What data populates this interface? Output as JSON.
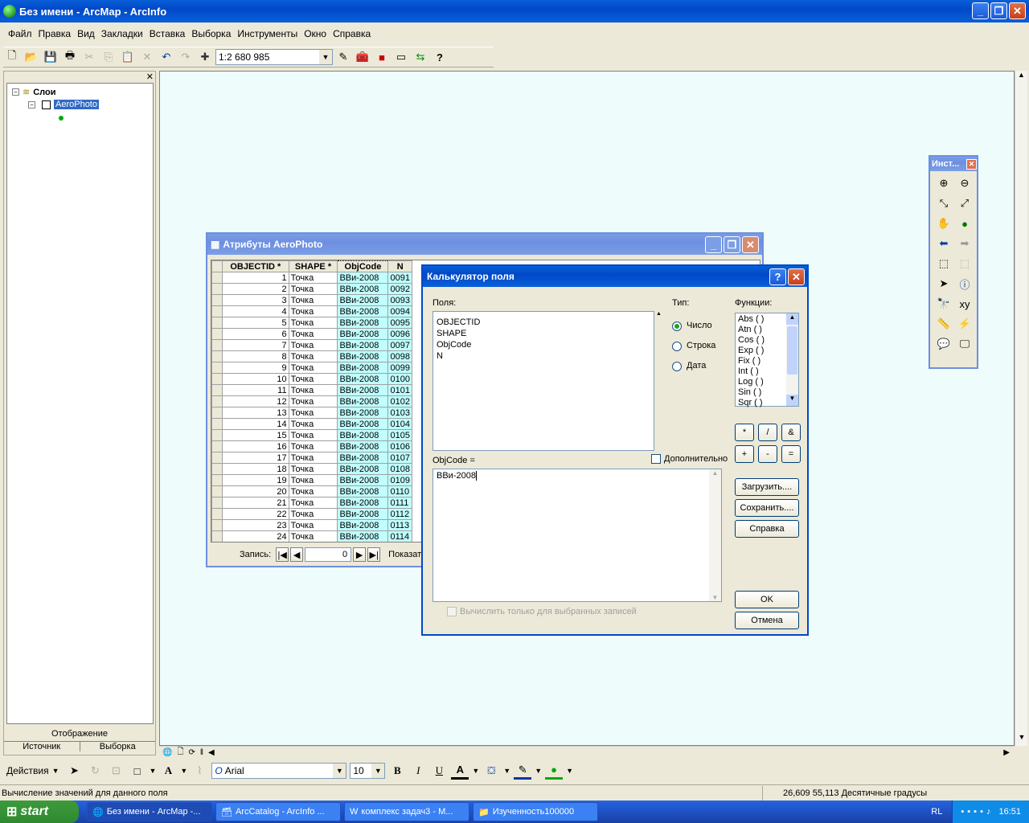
{
  "window": {
    "title": "Без имени - ArcMap - ArcInfo"
  },
  "menu": [
    "Файл",
    "Правка",
    "Вид",
    "Закладки",
    "Вставка",
    "Выборка",
    "Инструменты",
    "Окно",
    "Справка"
  ],
  "toolbar": {
    "scale": "1:2 680 985"
  },
  "toc": {
    "root": "Слои",
    "layer": "AeroPhoto",
    "tabs": [
      "Отображение",
      "Источник",
      "Выборка"
    ]
  },
  "tools_panel": {
    "title": "Инст..."
  },
  "attr": {
    "title": "Атрибуты AeroPhoto",
    "columns": [
      "OBJECTID *",
      "SHAPE *",
      "ObjCode",
      "N"
    ],
    "rows": [
      [
        "1",
        "Точка",
        "ВВи-2008",
        "0091"
      ],
      [
        "2",
        "Точка",
        "ВВи-2008",
        "0092"
      ],
      [
        "3",
        "Точка",
        "ВВи-2008",
        "0093"
      ],
      [
        "4",
        "Точка",
        "ВВи-2008",
        "0094"
      ],
      [
        "5",
        "Точка",
        "ВВи-2008",
        "0095"
      ],
      [
        "6",
        "Точка",
        "ВВи-2008",
        "0096"
      ],
      [
        "7",
        "Точка",
        "ВВи-2008",
        "0097"
      ],
      [
        "8",
        "Точка",
        "ВВи-2008",
        "0098"
      ],
      [
        "9",
        "Точка",
        "ВВи-2008",
        "0099"
      ],
      [
        "10",
        "Точка",
        "ВВи-2008",
        "0100"
      ],
      [
        "11",
        "Точка",
        "ВВи-2008",
        "0101"
      ],
      [
        "12",
        "Точка",
        "ВВи-2008",
        "0102"
      ],
      [
        "13",
        "Точка",
        "ВВи-2008",
        "0103"
      ],
      [
        "14",
        "Точка",
        "ВВи-2008",
        "0104"
      ],
      [
        "15",
        "Точка",
        "ВВи-2008",
        "0105"
      ],
      [
        "16",
        "Точка",
        "ВВи-2008",
        "0106"
      ],
      [
        "17",
        "Точка",
        "ВВи-2008",
        "0107"
      ],
      [
        "18",
        "Точка",
        "ВВи-2008",
        "0108"
      ],
      [
        "19",
        "Точка",
        "ВВи-2008",
        "0109"
      ],
      [
        "20",
        "Точка",
        "ВВи-2008",
        "0110"
      ],
      [
        "21",
        "Точка",
        "ВВи-2008",
        "0111"
      ],
      [
        "22",
        "Точка",
        "ВВи-2008",
        "0112"
      ],
      [
        "23",
        "Точка",
        "ВВи-2008",
        "0113"
      ],
      [
        "24",
        "Точка",
        "ВВи-2008",
        "0114"
      ]
    ],
    "record_label": "Запись:",
    "record_value": "0",
    "show_label": "Показат"
  },
  "calc": {
    "title": "Калькулятор поля",
    "fields_label": "Поля:",
    "fields": [
      "OBJECTID",
      "SHAPE",
      "ObjCode",
      "N"
    ],
    "type_label": "Тип:",
    "types": [
      "Число",
      "Строка",
      "Дата"
    ],
    "functions_label": "Функции:",
    "functions": [
      "Abs ( )",
      "Atn ( )",
      "Cos ( )",
      "Exp ( )",
      "Fix ( )",
      "Int ( )",
      "Log ( )",
      "Sin ( )",
      "Sqr ( )"
    ],
    "ops": [
      "*",
      "/",
      "&",
      "+",
      "-",
      "="
    ],
    "advanced": "Дополнительно",
    "expr_label": "ObjCode =",
    "expr": "ВВи-2008",
    "load": "Загрузить....",
    "save": "Сохранить....",
    "help": "Справка",
    "ok": "OK",
    "cancel": "Отмена",
    "selected_only": "Вычислить только для выбранных записей"
  },
  "drawbar": {
    "actions": "Действия",
    "font": "Arial",
    "size": "10"
  },
  "status": {
    "left": "Вычисление значений для данного поля",
    "right": "26,609  55,113 Десятичные градусы"
  },
  "taskbar": {
    "start": "start",
    "items": [
      "Без имени - ArcMap -...",
      "ArcCatalog - ArcInfo ...",
      "комплекс задач3 - М...",
      "Изученность100000"
    ],
    "lang": "RL",
    "clock": "16:51"
  }
}
